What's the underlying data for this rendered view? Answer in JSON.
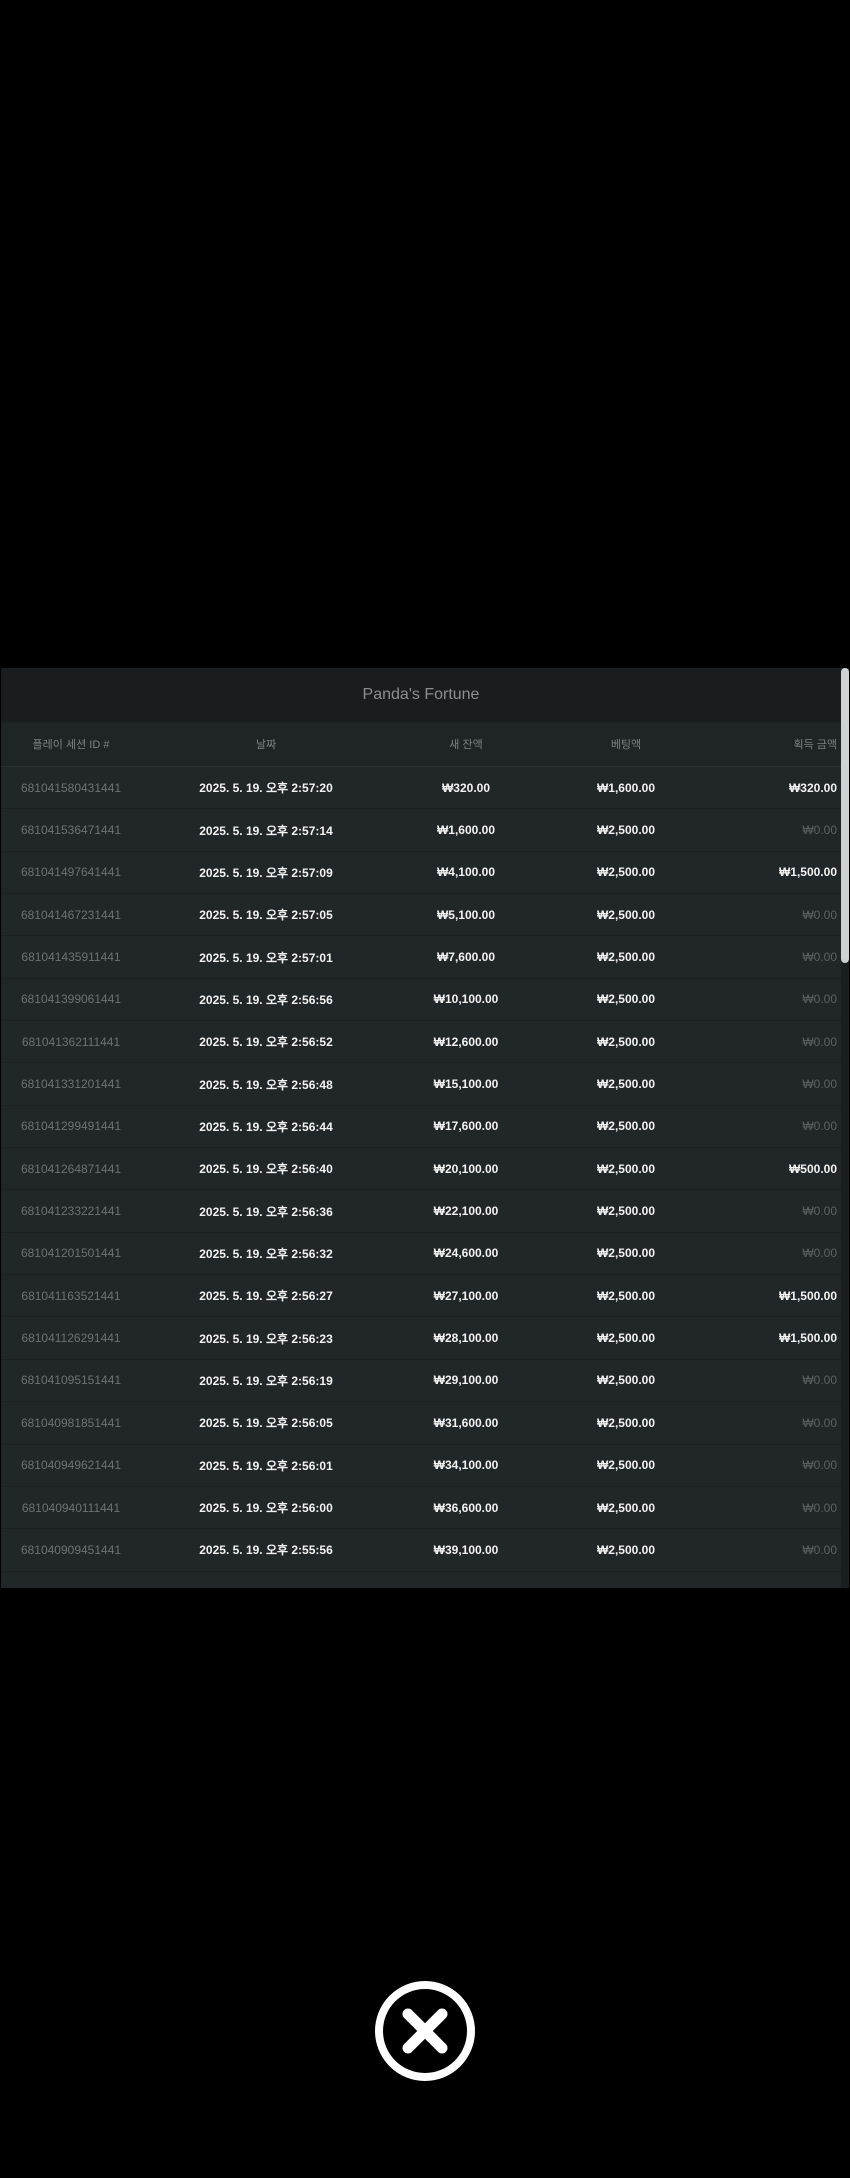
{
  "panel": {
    "title": "Panda's Fortune"
  },
  "table": {
    "headers": {
      "session_id": "플레이 세션 ID #",
      "date": "날짜",
      "balance": "새 잔액",
      "bet": "베팅액",
      "win": "획득 금액"
    },
    "rows": [
      {
        "id": "681041580431441",
        "date": "2025. 5. 19. 오후 2:57:20",
        "balance": "₩320.00",
        "bet": "₩1,600.00",
        "win": "₩320.00"
      },
      {
        "id": "681041536471441",
        "date": "2025. 5. 19. 오후 2:57:14",
        "balance": "₩1,600.00",
        "bet": "₩2,500.00",
        "win": "₩0.00"
      },
      {
        "id": "681041497641441",
        "date": "2025. 5. 19. 오후 2:57:09",
        "balance": "₩4,100.00",
        "bet": "₩2,500.00",
        "win": "₩1,500.00"
      },
      {
        "id": "681041467231441",
        "date": "2025. 5. 19. 오후 2:57:05",
        "balance": "₩5,100.00",
        "bet": "₩2,500.00",
        "win": "₩0.00"
      },
      {
        "id": "681041435911441",
        "date": "2025. 5. 19. 오후 2:57:01",
        "balance": "₩7,600.00",
        "bet": "₩2,500.00",
        "win": "₩0.00"
      },
      {
        "id": "681041399061441",
        "date": "2025. 5. 19. 오후 2:56:56",
        "balance": "₩10,100.00",
        "bet": "₩2,500.00",
        "win": "₩0.00"
      },
      {
        "id": "681041362111441",
        "date": "2025. 5. 19. 오후 2:56:52",
        "balance": "₩12,600.00",
        "bet": "₩2,500.00",
        "win": "₩0.00"
      },
      {
        "id": "681041331201441",
        "date": "2025. 5. 19. 오후 2:56:48",
        "balance": "₩15,100.00",
        "bet": "₩2,500.00",
        "win": "₩0.00"
      },
      {
        "id": "681041299491441",
        "date": "2025. 5. 19. 오후 2:56:44",
        "balance": "₩17,600.00",
        "bet": "₩2,500.00",
        "win": "₩0.00"
      },
      {
        "id": "681041264871441",
        "date": "2025. 5. 19. 오후 2:56:40",
        "balance": "₩20,100.00",
        "bet": "₩2,500.00",
        "win": "₩500.00"
      },
      {
        "id": "681041233221441",
        "date": "2025. 5. 19. 오후 2:56:36",
        "balance": "₩22,100.00",
        "bet": "₩2,500.00",
        "win": "₩0.00"
      },
      {
        "id": "681041201501441",
        "date": "2025. 5. 19. 오후 2:56:32",
        "balance": "₩24,600.00",
        "bet": "₩2,500.00",
        "win": "₩0.00"
      },
      {
        "id": "681041163521441",
        "date": "2025. 5. 19. 오후 2:56:27",
        "balance": "₩27,100.00",
        "bet": "₩2,500.00",
        "win": "₩1,500.00"
      },
      {
        "id": "681041126291441",
        "date": "2025. 5. 19. 오후 2:56:23",
        "balance": "₩28,100.00",
        "bet": "₩2,500.00",
        "win": "₩1,500.00"
      },
      {
        "id": "681041095151441",
        "date": "2025. 5. 19. 오후 2:56:19",
        "balance": "₩29,100.00",
        "bet": "₩2,500.00",
        "win": "₩0.00"
      },
      {
        "id": "681040981851441",
        "date": "2025. 5. 19. 오후 2:56:05",
        "balance": "₩31,600.00",
        "bet": "₩2,500.00",
        "win": "₩0.00"
      },
      {
        "id": "681040949621441",
        "date": "2025. 5. 19. 오후 2:56:01",
        "balance": "₩34,100.00",
        "bet": "₩2,500.00",
        "win": "₩0.00"
      },
      {
        "id": "681040940111441",
        "date": "2025. 5. 19. 오후 2:56:00",
        "balance": "₩36,600.00",
        "bet": "₩2,500.00",
        "win": "₩0.00"
      },
      {
        "id": "681040909451441",
        "date": "2025. 5. 19. 오후 2:55:56",
        "balance": "₩39,100.00",
        "bet": "₩2,500.00",
        "win": "₩0.00"
      }
    ]
  },
  "close_button": {
    "icon": "close-icon"
  },
  "colors": {
    "background": "#000000",
    "panel": "#212628",
    "title_bar": "#1a1d1f",
    "text_primary": "#f2f2f2",
    "text_muted": "#6d7275"
  }
}
